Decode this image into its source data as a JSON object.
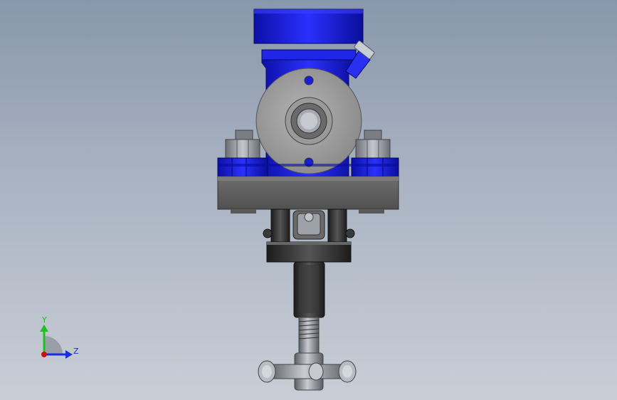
{
  "viewport": {
    "background_top": "#8897ab",
    "background_bottom": "#c9ced6"
  },
  "model": {
    "body_color": "#1a1ed6",
    "flange_color": "#8f8f8f",
    "metal_dark": "#4a4a4a",
    "metal_light": "#b8bcc4"
  },
  "triad": {
    "y_label": "Y",
    "z_label": "Z",
    "y_color": "#20c020",
    "z_color": "#1a2ee0",
    "origin_color": "#d01010"
  }
}
